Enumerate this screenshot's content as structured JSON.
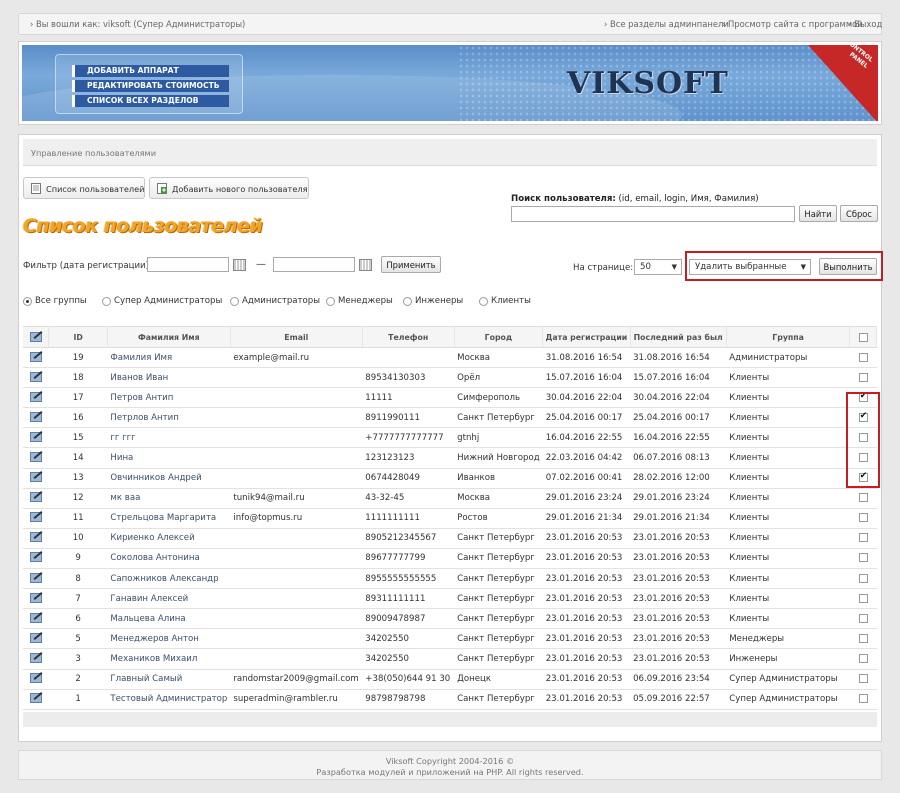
{
  "topbar": {
    "logged_in": "› Вы вошли как: viksoft (Супер Администраторы)",
    "all_sections": "› Все разделы админпанели",
    "view_site": "› Просмотр сайта с программой",
    "logout": "› Выход"
  },
  "banner": {
    "menu": [
      "ДОБАВИТЬ АППАРАТ",
      "РЕДАКТИРОВАТЬ СТОИМОСТЬ",
      "СПИСОК ВСЕХ РАЗДЕЛОВ"
    ],
    "logo": "VIKSOFT",
    "corner_text_1": "CONTROL",
    "corner_text_2": "PANEL"
  },
  "breadcrumb": "Управление пользователями",
  "tabs": {
    "list": "Список пользователей",
    "add": "Добавить нового пользователя"
  },
  "search": {
    "label_bold": "Поиск пользователя:",
    "label_hint": " (id, email, login, Имя, Фамилия)",
    "find_button": "Найти",
    "reset_button": "Сброс",
    "value": ""
  },
  "page_title": "Список пользователей",
  "filter": {
    "label": "Фильтр (дата регистрации):",
    "dash": "—",
    "apply_button": "Применить"
  },
  "perpage": {
    "label": "На странице:",
    "value": "50"
  },
  "bulk_action": {
    "selected": "Удалить выбранные",
    "execute_button": "Выполнить"
  },
  "groups": [
    {
      "label": "Все группы",
      "selected": true
    },
    {
      "label": "Супер Администраторы",
      "selected": false
    },
    {
      "label": "Администраторы",
      "selected": false
    },
    {
      "label": "Менеджеры",
      "selected": false
    },
    {
      "label": "Инженеры",
      "selected": false
    },
    {
      "label": "Клиенты",
      "selected": false
    }
  ],
  "table": {
    "headers": [
      "ID",
      "Фамилия Имя",
      "Email",
      "Телефон",
      "Город",
      "Дата регистрации",
      "Последний раз был",
      "Группа"
    ],
    "rows": [
      {
        "id": "19",
        "name": "Фамилия Имя",
        "email": "example@mail.ru",
        "phone": "",
        "city": "Москва",
        "reg": "31.08.2016 16:54",
        "last": "31.08.2016 16:54",
        "group": "Администраторы",
        "checked": false
      },
      {
        "id": "18",
        "name": "Иванов Иван",
        "email": "",
        "phone": "89534130303",
        "city": "Орёл",
        "reg": "15.07.2016 16:04",
        "last": "15.07.2016 16:04",
        "group": "Клиенты",
        "checked": false
      },
      {
        "id": "17",
        "name": "Петров Антип",
        "email": "",
        "phone": "11111",
        "city": "Симферополь",
        "reg": "30.04.2016 22:04",
        "last": "30.04.2016 22:04",
        "group": "Клиенты",
        "checked": true
      },
      {
        "id": "16",
        "name": "Петрлов Антип",
        "email": "",
        "phone": "8911990111",
        "city": "Санкт Петербург",
        "reg": "25.04.2016 00:17",
        "last": "25.04.2016 00:17",
        "group": "Клиенты",
        "checked": true
      },
      {
        "id": "15",
        "name": "гг ггг",
        "email": "",
        "phone": "+7777777777777",
        "city": "gtnhj",
        "reg": "16.04.2016 22:55",
        "last": "16.04.2016 22:55",
        "group": "Клиенты",
        "checked": false
      },
      {
        "id": "14",
        "name": "Нина",
        "email": "",
        "phone": "123123123",
        "city": "Нижний Новгород",
        "reg": "22.03.2016 04:42",
        "last": "06.07.2016 08:13",
        "group": "Клиенты",
        "checked": false
      },
      {
        "id": "13",
        "name": "Овчинников Андрей",
        "email": "",
        "phone": "0674428049",
        "city": "Иванков",
        "reg": "07.02.2016 00:41",
        "last": "28.02.2016 12:00",
        "group": "Клиенты",
        "checked": true
      },
      {
        "id": "12",
        "name": "мк ваа",
        "email": "tunik94@mail.ru",
        "phone": "43-32-45",
        "city": "Москва",
        "reg": "29.01.2016 23:24",
        "last": "29.01.2016 23:24",
        "group": "Клиенты",
        "checked": false
      },
      {
        "id": "11",
        "name": "Стрельцова Маргарита",
        "email": "info@topmus.ru",
        "phone": "1111111111",
        "city": "Ростов",
        "reg": "29.01.2016 21:34",
        "last": "29.01.2016 21:34",
        "group": "Клиенты",
        "checked": false
      },
      {
        "id": "10",
        "name": "Кириенко Алексей",
        "email": "",
        "phone": "8905212345567",
        "city": "Санкт Петербург",
        "reg": "23.01.2016 20:53",
        "last": "23.01.2016 20:53",
        "group": "Клиенты",
        "checked": false
      },
      {
        "id": "9",
        "name": "Соколова Антонина",
        "email": "",
        "phone": "89677777799",
        "city": "Санкт Петербург",
        "reg": "23.01.2016 20:53",
        "last": "23.01.2016 20:53",
        "group": "Клиенты",
        "checked": false
      },
      {
        "id": "8",
        "name": "Сапожников Александр",
        "email": "",
        "phone": "8955555555555",
        "city": "Санкт Петербург",
        "reg": "23.01.2016 20:53",
        "last": "23.01.2016 20:53",
        "group": "Клиенты",
        "checked": false
      },
      {
        "id": "7",
        "name": "Ганавин Алексей",
        "email": "",
        "phone": "89311111111",
        "city": "Санкт Петербург",
        "reg": "23.01.2016 20:53",
        "last": "23.01.2016 20:53",
        "group": "Клиенты",
        "checked": false
      },
      {
        "id": "6",
        "name": "Мальцева Алина",
        "email": "",
        "phone": "89009478987",
        "city": "Санкт Петербург",
        "reg": "23.01.2016 20:53",
        "last": "23.01.2016 20:53",
        "group": "Клиенты",
        "checked": false
      },
      {
        "id": "5",
        "name": "Менеджеров Антон",
        "email": "",
        "phone": "34202550",
        "city": "Санкт Петербург",
        "reg": "23.01.2016 20:53",
        "last": "23.01.2016 20:53",
        "group": "Менеджеры",
        "checked": false
      },
      {
        "id": "3",
        "name": "Механиков Михаил",
        "email": "",
        "phone": "34202550",
        "city": "Санкт Петербург",
        "reg": "23.01.2016 20:53",
        "last": "23.01.2016 20:53",
        "group": "Инженеры",
        "checked": false
      },
      {
        "id": "2",
        "name": "Главный Самый",
        "email": "randomstar2009@gmail.com",
        "phone": "+38(050)644 91 30",
        "city": "Донецк",
        "reg": "23.01.2016 20:53",
        "last": "06.09.2016 23:54",
        "group": "Супер Администраторы",
        "checked": false
      },
      {
        "id": "1",
        "name": "Тестовый Администратор",
        "email": "superadmin@rambler.ru",
        "phone": "98798798798",
        "city": "Санкт Петербург",
        "reg": "23.01.2016 20:53",
        "last": "05.09.2016 22:57",
        "group": "Супер Администраторы",
        "checked": false
      }
    ]
  },
  "footer": {
    "line1": "Viksoft   Copyright 2004-2016 ©",
    "line2": "Разработка модулей и приложений на PHP. All rights reserved."
  }
}
